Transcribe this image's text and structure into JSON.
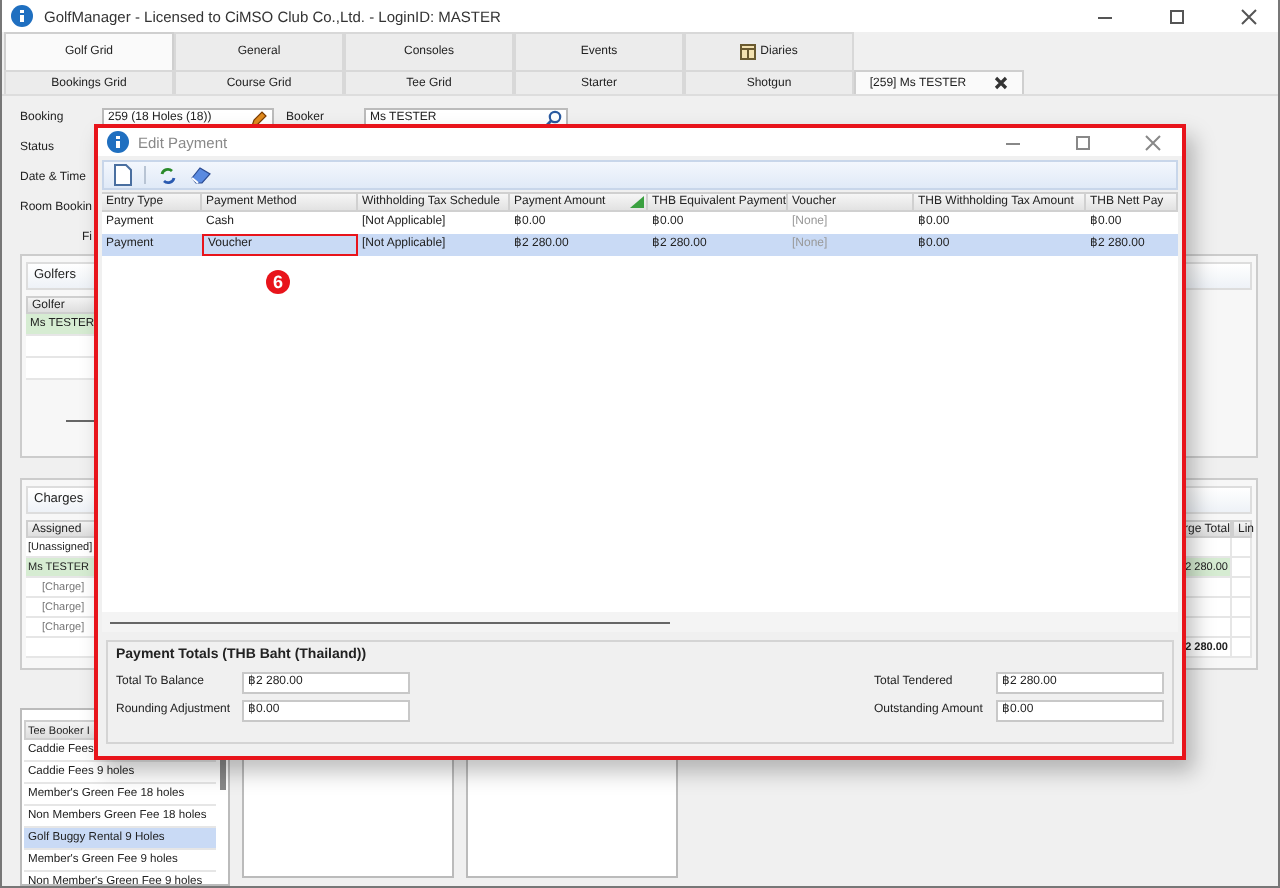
{
  "window": {
    "title": "GolfManager - Licensed to CiMSO Club Co.,Ltd. - LoginID: MASTER"
  },
  "main_tabs": [
    {
      "label": "Golf Grid",
      "selected": true,
      "kind": "plain"
    },
    {
      "label": "General",
      "selected": false,
      "kind": "plain"
    },
    {
      "label": "Consoles",
      "selected": false,
      "kind": "plain"
    },
    {
      "label": "Events",
      "selected": false,
      "kind": "plain"
    },
    {
      "label": "Diaries",
      "selected": false,
      "kind": "calendar"
    }
  ],
  "sub_tabs": [
    {
      "label": "Bookings Grid",
      "selected": false,
      "closable": false
    },
    {
      "label": "Course Grid",
      "selected": false,
      "closable": false
    },
    {
      "label": "Tee Grid",
      "selected": false,
      "closable": false
    },
    {
      "label": "Starter",
      "selected": false,
      "closable": false
    },
    {
      "label": "Shotgun",
      "selected": false,
      "closable": false
    },
    {
      "label": "[259] Ms TESTER",
      "selected": true,
      "closable": true
    }
  ],
  "booking_form": {
    "booking_label": "Booking",
    "booking": "259 (18 Holes (18))",
    "booker_label": "Booker",
    "booker": "Ms TESTER",
    "labels": [
      "Status",
      "Date & Time",
      "Room Bookin"
    ],
    "section_label": "Fi"
  },
  "golfers": {
    "title": "Golfers",
    "column": "Golfer",
    "rows": [
      {
        "name": "Ms TESTER",
        "selected": true
      }
    ]
  },
  "charges": {
    "title": "Charges",
    "columns": [
      "Assigned",
      "rge Total",
      "Lin"
    ],
    "rows": [
      {
        "label": "[Unassigned]",
        "selected": false
      },
      {
        "label": "Ms TESTER",
        "selected": true,
        "total": "2 280.00",
        "children": [
          {
            "label": "[Charge]",
            "selected": false
          },
          {
            "label": "[Charge]",
            "selected": false
          },
          {
            "label": "[Charge]",
            "selected": false
          }
        ]
      }
    ],
    "footer_total": "2 280.00"
  },
  "products": {
    "column": "Tee Booker I",
    "items": [
      {
        "label": "Caddie Fees",
        "selected": false
      },
      {
        "label": "Caddie Fees 9 holes",
        "selected": false
      },
      {
        "label": "Member's Green Fee 18 holes",
        "selected": false
      },
      {
        "label": "Non Members Green Fee 18 holes",
        "selected": false
      },
      {
        "label": "Golf Buggy Rental 9 Holes",
        "selected": true
      },
      {
        "label": "Member's Green Fee 9 holes",
        "selected": false
      },
      {
        "label": "Non Member's Green Fee 9 holes",
        "selected": false
      }
    ]
  },
  "dialog": {
    "title": "Edit Payment",
    "columns": [
      {
        "label": "Entry Type",
        "sorted": false
      },
      {
        "label": "Payment Method",
        "sorted": false
      },
      {
        "label": "Withholding Tax Schedule",
        "sorted": false
      },
      {
        "label": "Payment Amount",
        "sorted": true
      },
      {
        "label": "THB Equivalent Payment",
        "sorted": false
      },
      {
        "label": "Voucher",
        "sorted": false
      },
      {
        "label": "THB Withholding Tax Amount",
        "sorted": false
      },
      {
        "label": "THB Nett Pay",
        "sorted": false
      }
    ],
    "rows": [
      {
        "selected": false,
        "cells": [
          {
            "text": "Payment",
            "outlined": false,
            "dimmed": false
          },
          {
            "text": "Cash",
            "outlined": false,
            "dimmed": false
          },
          {
            "text": "[Not Applicable]",
            "outlined": false,
            "dimmed": false
          },
          {
            "text": "฿0.00",
            "outlined": false,
            "dimmed": false
          },
          {
            "text": "฿0.00",
            "outlined": false,
            "dimmed": false
          },
          {
            "text": "[None]",
            "outlined": false,
            "dimmed": true
          },
          {
            "text": "฿0.00",
            "outlined": false,
            "dimmed": false
          },
          {
            "text": "฿0.00",
            "outlined": false,
            "dimmed": false
          }
        ]
      },
      {
        "selected": true,
        "cells": [
          {
            "text": "Payment",
            "outlined": false,
            "dimmed": false
          },
          {
            "text": "Voucher",
            "outlined": true,
            "dimmed": false
          },
          {
            "text": "[Not Applicable]",
            "outlined": false,
            "dimmed": false
          },
          {
            "text": "฿2 280.00",
            "outlined": false,
            "dimmed": false
          },
          {
            "text": "฿2 280.00",
            "outlined": false,
            "dimmed": false
          },
          {
            "text": "[None]",
            "outlined": false,
            "dimmed": true
          },
          {
            "text": "฿0.00",
            "outlined": false,
            "dimmed": false
          },
          {
            "text": "฿2 280.00",
            "outlined": false,
            "dimmed": false
          }
        ]
      }
    ],
    "step_badge": "6",
    "totals": {
      "title": "Payment Totals (THB Baht (Thailand))",
      "left": [
        {
          "label": "Total To Balance",
          "value": "฿2 280.00"
        },
        {
          "label": "Rounding Adjustment",
          "value": "฿0.00"
        }
      ],
      "right": [
        {
          "label": "Total Tendered",
          "value": "฿2 280.00"
        },
        {
          "label": "Outstanding Amount",
          "value": "฿0.00"
        }
      ]
    }
  }
}
